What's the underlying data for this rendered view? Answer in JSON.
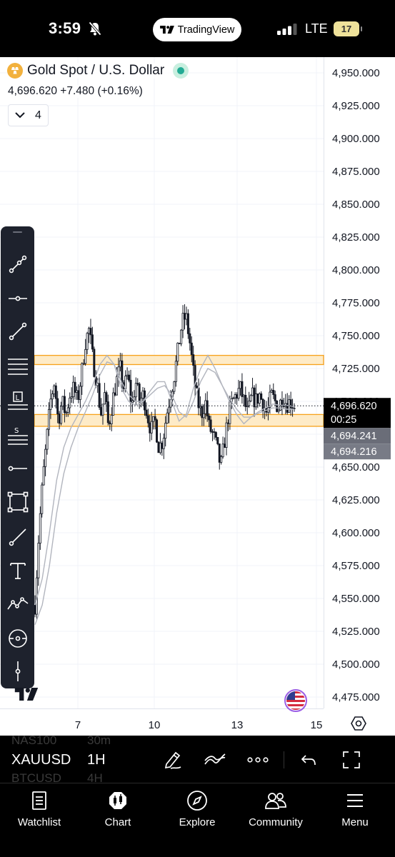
{
  "status_bar": {
    "time": "3:59",
    "app_pill": "TradingView",
    "network": "LTE",
    "battery": "17"
  },
  "header": {
    "symbol_title": "Gold Spot / U.S. Dollar",
    "last_price": "4,696.620",
    "change": "+7.480",
    "change_pct": "(+0.16%)",
    "indicator_count": "4"
  },
  "chart_data": {
    "type": "candlestick",
    "interval": "1H",
    "y_ticks": [
      4950,
      4925,
      4900,
      4875,
      4850,
      4825,
      4800,
      4775,
      4750,
      4725,
      4700,
      4675,
      4650,
      4625,
      4600,
      4575,
      4550,
      4525,
      4500,
      4475
    ],
    "y_tick_labels": [
      "4,950.000",
      "4,925.000",
      "4,900.000",
      "4,875.000",
      "4,850.000",
      "4,825.000",
      "4,800.000",
      "4,775.000",
      "4,750.000",
      "4,725.000",
      "4,700.000",
      "4,675.000",
      "4,650.000",
      "4,625.000",
      "4,600.000",
      "4,575.000",
      "4,550.000",
      "4,525.000",
      "4,500.000",
      "4,475.000"
    ],
    "x_tick_labels": [
      "7",
      "10",
      "13",
      "15"
    ],
    "ylim": [
      4469,
      4972
    ],
    "current_price_label": "4,696.620",
    "countdown": "00:25",
    "ma_labels": [
      "4,694.241",
      "4,694.216"
    ],
    "current_price": 4696.62,
    "zones": [
      {
        "low": 4728,
        "high": 4735,
        "color": "#f7a21b"
      },
      {
        "low": 4681,
        "high": 4690,
        "color": "#f7a21b"
      }
    ],
    "close_path": [
      4545,
      4600,
      4640,
      4670,
      4700,
      4715,
      4685,
      4700,
      4690,
      4705,
      4710,
      4700,
      4720,
      4745,
      4755,
      4730,
      4715,
      4690,
      4705,
      4680,
      4700,
      4715,
      4725,
      4710,
      4720,
      4695,
      4715,
      4700,
      4705,
      4690,
      4678,
      4685,
      4665,
      4670,
      4690,
      4705,
      4720,
      4740,
      4760,
      4765,
      4745,
      4720,
      4700,
      4690,
      4700,
      4680,
      4675,
      4665,
      4650,
      4670,
      4690,
      4700,
      4705,
      4710,
      4700,
      4690,
      4705,
      4700,
      4705,
      4698,
      4690,
      4705,
      4700,
      4695,
      4705,
      4698,
      4700,
      4697
    ],
    "ma_fast": [
      4545,
      4565,
      4600,
      4640,
      4665,
      4680,
      4690,
      4700,
      4712,
      4728,
      4735,
      4728,
      4710,
      4700,
      4697,
      4700,
      4708,
      4715,
      4715,
      4700,
      4685,
      4690,
      4710,
      4725,
      4735,
      4725,
      4712,
      4700,
      4690,
      4683,
      4688,
      4692,
      4695,
      4698,
      4697,
      4697,
      4696
    ],
    "ma_slow": [
      4530,
      4545,
      4575,
      4615,
      4645,
      4665,
      4680,
      4692,
      4705,
      4720,
      4730,
      4728,
      4715,
      4705,
      4700,
      4700,
      4705,
      4710,
      4712,
      4705,
      4692,
      4688,
      4700,
      4715,
      4725,
      4722,
      4712,
      4702,
      4694,
      4688,
      4688,
      4691,
      4693,
      4695,
      4695,
      4694,
      4694
    ],
    "colors": {
      "zone_fill": "#fde4b4",
      "zone_line": "#f7a21b",
      "ma": "#b2b5be",
      "candle": "#131722"
    }
  },
  "toolbar": {
    "symbol": "XAUUSD",
    "interval": "1H",
    "ghost_rows": [
      [
        "NAS100",
        "30m"
      ],
      [
        "BTCUSD",
        "4H"
      ]
    ]
  },
  "nav": {
    "items": [
      "Watchlist",
      "Chart",
      "Explore",
      "Community",
      "Menu"
    ]
  }
}
